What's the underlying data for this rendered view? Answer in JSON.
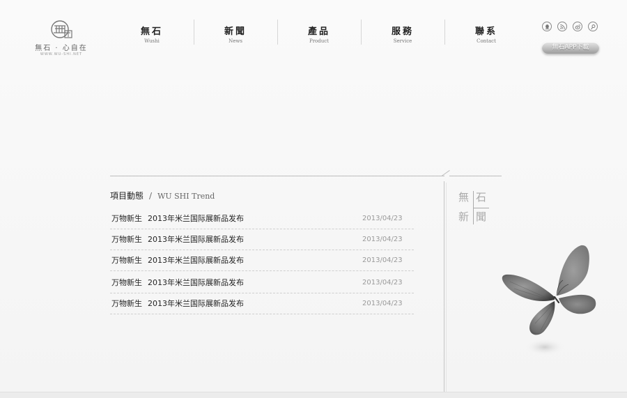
{
  "logo": {
    "name": "無石 · 心自在",
    "sub": "WWW.WU-SHI.NET"
  },
  "nav": [
    {
      "zh": "無石",
      "en": "Wushi"
    },
    {
      "zh": "新聞",
      "en": "News"
    },
    {
      "zh": "產品",
      "en": "Product"
    },
    {
      "zh": "服務",
      "en": "Service"
    },
    {
      "zh": "聯系",
      "en": "Contact"
    }
  ],
  "social": [
    {
      "icon": "qq-icon"
    },
    {
      "icon": "rss-icon"
    },
    {
      "icon": "weibo-icon"
    },
    {
      "icon": "tencent-weibo-icon"
    }
  ],
  "app_button": "無石APP下載",
  "section": {
    "title": "項目動態",
    "separator": "/",
    "title_en": "WU SHI Trend"
  },
  "news": [
    {
      "category": "万物新生",
      "title": "2013年米兰国际展新品发布",
      "date": "2013/04/23"
    },
    {
      "category": "万物新生",
      "title": "2013年米兰国际展新品发布",
      "date": "2013/04/23"
    },
    {
      "category": "万物新生",
      "title": "2013年米兰国际展新品发布",
      "date": "2013/04/23"
    },
    {
      "category": "万物新生",
      "title": "2013年米兰国际展新品发布",
      "date": "2013/04/23"
    },
    {
      "category": "万物新生",
      "title": "2013年米兰国际展新品发布",
      "date": "2013/04/23"
    }
  ],
  "side_label": [
    "無",
    "石",
    "新",
    "聞"
  ],
  "colors": {
    "background": "#f7f7f7",
    "text": "#222222",
    "muted": "#999999"
  }
}
